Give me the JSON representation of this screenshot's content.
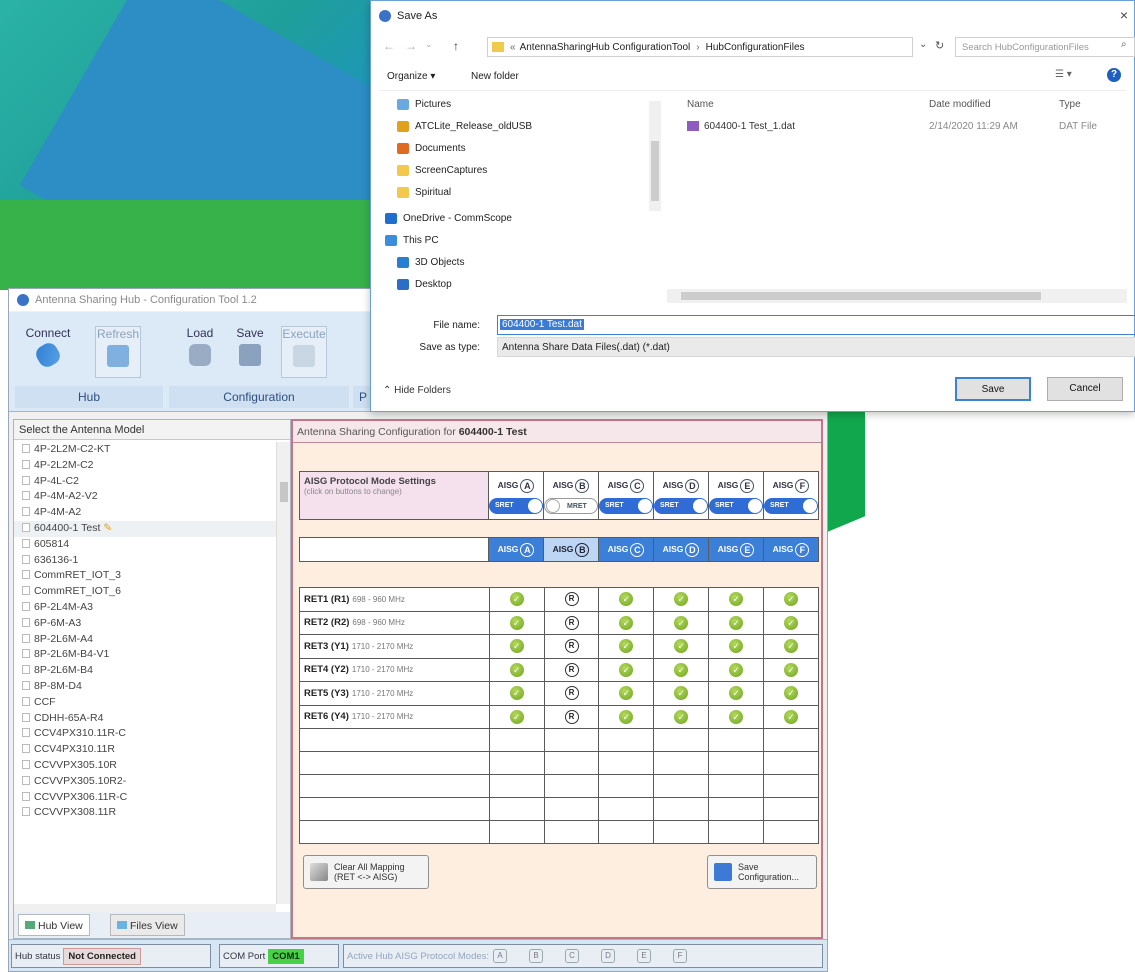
{
  "dialog": {
    "title": "Save As",
    "close": "×",
    "breadcrumb": [
      "AntennaSharingHub ConfigurationTool",
      "HubConfigurationFiles"
    ],
    "search_placeholder": "Search HubConfigurationFiles",
    "organize": "Organize ▾",
    "new_folder": "New folder",
    "nav_items": [
      "Pictures",
      "ATCLite_Release_oldUSB",
      "Documents",
      "ScreenCaptures",
      "Spiritual",
      "OneDrive - CommScope",
      "This PC",
      "3D Objects",
      "Desktop"
    ],
    "columns": {
      "name": "Name",
      "date": "Date modified",
      "type": "Type"
    },
    "files": [
      {
        "name": "604400-1 Test_1.dat",
        "date": "2/14/2020 11:29 AM",
        "type": "DAT File"
      }
    ],
    "file_name_label": "File name:",
    "file_name_value": "604400-1 Test.dat",
    "save_type_label": "Save as type:",
    "save_type_value": "Antenna Share Data Files(.dat) (*.dat)",
    "hide_folders": "Hide Folders",
    "save_button": "Save",
    "cancel_button": "Cancel"
  },
  "app": {
    "title": "Antenna Sharing Hub - Configuration Tool 1.2",
    "ribbon": {
      "connect": "Connect",
      "refresh": "Refresh",
      "load": "Load",
      "save": "Save",
      "execute": "Execute",
      "group_hub": "Hub",
      "group_config": "Configuration",
      "group_trunc": "P"
    },
    "left": {
      "header": "Select the Antenna Model",
      "models": [
        "4P-2L2M-C2-KT",
        "4P-2L2M-C2",
        "4P-4L-C2",
        "4P-4M-A2-V2",
        "4P-4M-A2",
        "604400-1 Test",
        "605814",
        "636136-1",
        "CommRET_IOT_3",
        "CommRET_IOT_6",
        "6P-2L4M-A3",
        "6P-6M-A3",
        "8P-2L6M-A4",
        "8P-2L6M-B4-V1",
        "8P-2L6M-B4",
        "8P-8M-D4",
        "CCF",
        "CDHH-65A-R4",
        "CCV4PX310.11R-C",
        "CCV4PX310.11R",
        "CCVVPX305.10R",
        "CCVVPX305.10R2-",
        "CCVVPX306.11R-C",
        "CCVVPX308.11R"
      ],
      "tab_hub": "Hub View",
      "tab_files": "Files View"
    },
    "config": {
      "title_prefix": "Antenna Sharing Configuration for",
      "title_model": "604400-1 Test",
      "aisg_label": "AISG Protocol Mode Settings",
      "aisg_hint": "(click on buttons to change)",
      "aisg_word": "AISG",
      "ports": [
        "A",
        "B",
        "C",
        "D",
        "E",
        "F"
      ],
      "toggles": [
        "SRET",
        "MRET",
        "SRET",
        "SRET",
        "SRET",
        "SRET"
      ],
      "rets": [
        {
          "name": "RET1 (R1)",
          "freq": "698 - 960 MHz"
        },
        {
          "name": "RET2 (R2)",
          "freq": "698 - 960 MHz"
        },
        {
          "name": "RET3 (Y1)",
          "freq": "1710 - 2170 MHz"
        },
        {
          "name": "RET4 (Y2)",
          "freq": "1710 - 2170 MHz"
        },
        {
          "name": "RET5 (Y3)",
          "freq": "1710 - 2170 MHz"
        },
        {
          "name": "RET6 (Y4)",
          "freq": "1710 - 2170 MHz"
        }
      ],
      "r_mark": "R",
      "check_mark": "✓",
      "clear_btn_1": "Clear All Mapping",
      "clear_btn_2": "(RET <-> AISG)",
      "save_btn_1": "Save",
      "save_btn_2": "Configuration..."
    },
    "status": {
      "hub_label": "Hub status",
      "hub_value": "Not Connected",
      "com_label": "COM Port",
      "com_value": "COM1",
      "active_label": "Active Hub AISG Protocol Modes:",
      "active_modes": [
        "A",
        "B",
        "C",
        "D",
        "E",
        "F"
      ]
    }
  },
  "colors": {
    "accent_green": "#11a84d",
    "ribbon_blue": "#dce9f7",
    "header_blue": "#3b7fd8",
    "status_green": "#47d147"
  }
}
